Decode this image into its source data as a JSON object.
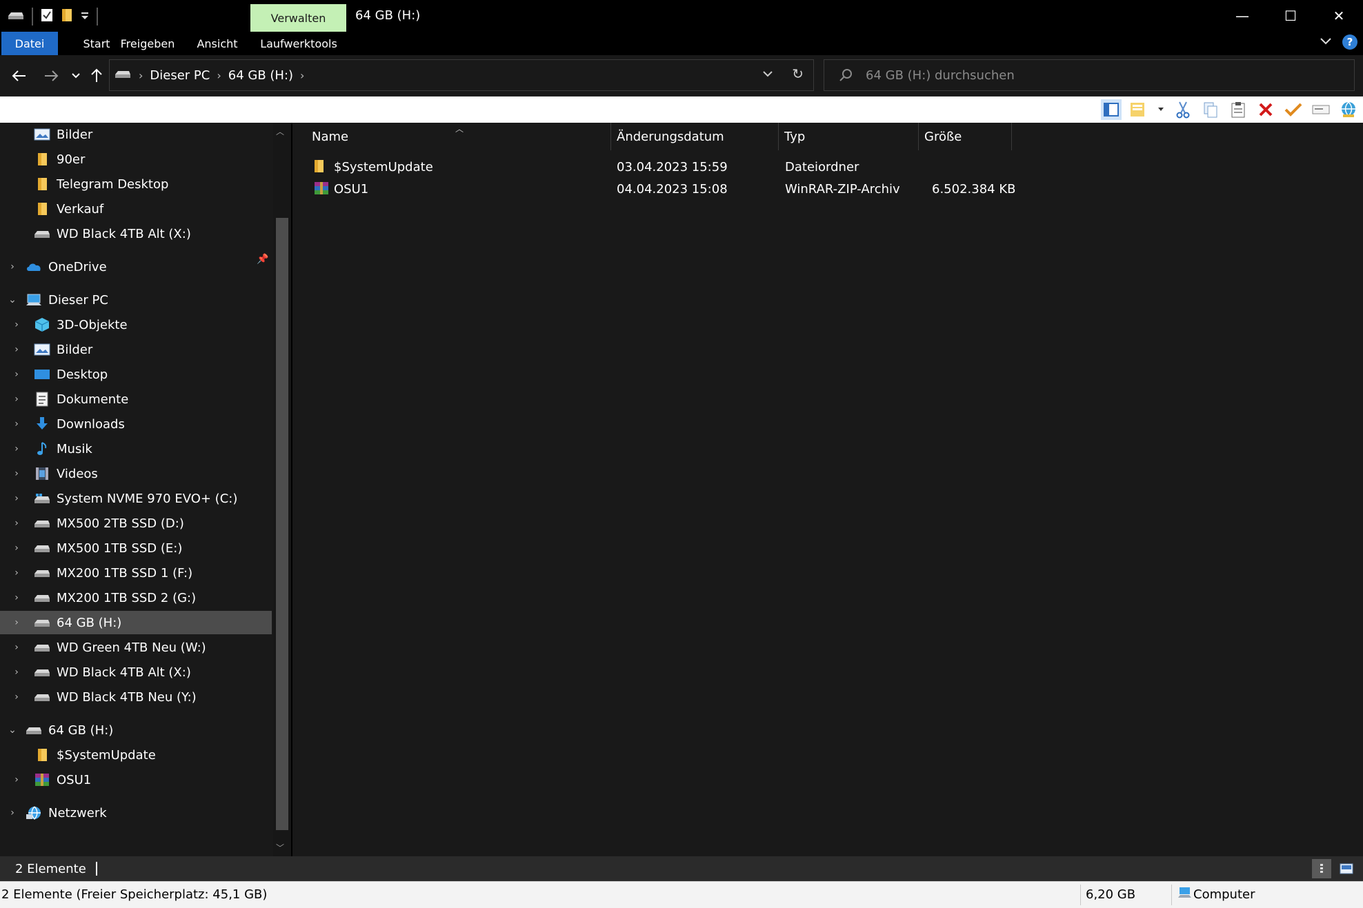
{
  "window": {
    "title": "64 GB (H:)",
    "context_tab": "Verwalten",
    "controls": {
      "minimize": "—",
      "maximize": "☐",
      "close": "✕"
    }
  },
  "ribbon": {
    "tabs": [
      "Datei",
      "Start",
      "Freigeben",
      "Ansicht",
      "Laufwerktools"
    ],
    "help": "?"
  },
  "address": {
    "crumbs": [
      "Dieser PC",
      "64 GB (H:)"
    ]
  },
  "search": {
    "placeholder": "64 GB (H:) durchsuchen"
  },
  "nav": {
    "items": [
      {
        "label": "Bilder",
        "icon": "pictures-icon"
      },
      {
        "label": "90er",
        "icon": "folder-icon"
      },
      {
        "label": "Telegram Desktop",
        "icon": "folder-icon"
      },
      {
        "label": "Verkauf",
        "icon": "folder-icon"
      },
      {
        "label": "WD Black 4TB Alt (X:)",
        "icon": "drive-icon"
      },
      {
        "label": "OneDrive",
        "icon": "onedrive-icon"
      },
      {
        "label": "Dieser PC",
        "icon": "computer-icon"
      },
      {
        "label": "3D-Objekte",
        "icon": "3d-objects-icon"
      },
      {
        "label": "Bilder",
        "icon": "pictures-icon"
      },
      {
        "label": "Desktop",
        "icon": "desktop-icon"
      },
      {
        "label": "Dokumente",
        "icon": "documents-icon"
      },
      {
        "label": "Downloads",
        "icon": "downloads-icon"
      },
      {
        "label": "Musik",
        "icon": "music-icon"
      },
      {
        "label": "Videos",
        "icon": "videos-icon"
      },
      {
        "label": "System NVME 970 EVO+ (C:)",
        "icon": "system-drive-icon"
      },
      {
        "label": "MX500 2TB SSD (D:)",
        "icon": "drive-icon"
      },
      {
        "label": "MX500 1TB SSD (E:)",
        "icon": "drive-icon"
      },
      {
        "label": "MX200 1TB SSD 1 (F:)",
        "icon": "drive-icon"
      },
      {
        "label": "MX200 1TB SSD 2 (G:)",
        "icon": "drive-icon"
      },
      {
        "label": "64 GB (H:)",
        "icon": "drive-icon"
      },
      {
        "label": "WD Green 4TB Neu (W:)",
        "icon": "drive-icon"
      },
      {
        "label": "WD Black 4TB Alt (X:)",
        "icon": "drive-icon"
      },
      {
        "label": "WD Black 4TB Neu (Y:)",
        "icon": "drive-icon"
      },
      {
        "label": "64 GB (H:)",
        "icon": "drive-icon"
      },
      {
        "label": "$SystemUpdate",
        "icon": "folder-icon"
      },
      {
        "label": "OSU1",
        "icon": "winrar-icon"
      },
      {
        "label": "Netzwerk",
        "icon": "network-icon"
      }
    ]
  },
  "columns": [
    "Name",
    "Änderungsdatum",
    "Typ",
    "Größe"
  ],
  "files": [
    {
      "name": "$SystemUpdate",
      "date": "03.04.2023 15:59",
      "type": "Dateiordner",
      "size": "",
      "icon": "folder-icon"
    },
    {
      "name": "OSU1",
      "date": "04.04.2023 15:08",
      "type": "WinRAR-ZIP-Archiv",
      "size": "6.502.384 KB",
      "icon": "winrar-icon"
    }
  ],
  "status": {
    "count": "2 Elemente",
    "bottom_left": "2 Elemente (Freier Speicherplatz: 45,1 GB)",
    "bottom_size": "6,20 GB",
    "bottom_location": "Computer"
  }
}
